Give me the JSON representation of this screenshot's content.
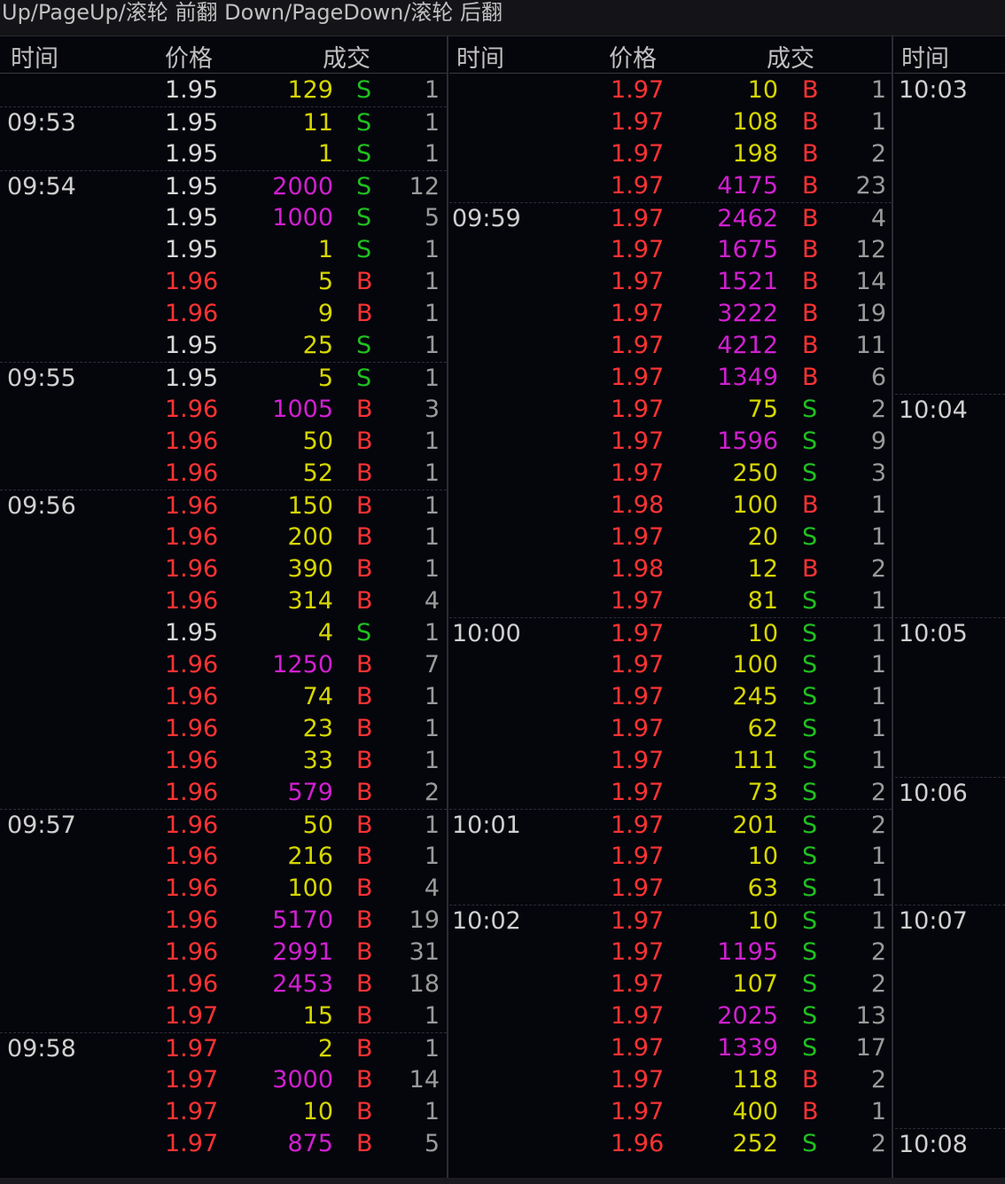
{
  "hint": "Up/PageUp/滚轮 前翻 Down/PageDown/滚轮 后翻",
  "headers": {
    "time": "时间",
    "price": "价格",
    "volume": "成交"
  },
  "left_rows": [
    {
      "t": "",
      "p": "1.95",
      "v": "129",
      "s": "S",
      "c": "1"
    },
    {
      "t": "09:53",
      "p": "1.95",
      "v": "11",
      "s": "S",
      "c": "1"
    },
    {
      "t": "",
      "p": "1.95",
      "v": "1",
      "s": "S",
      "c": "1"
    },
    {
      "t": "09:54",
      "p": "1.95",
      "v": "2000",
      "s": "S",
      "c": "12"
    },
    {
      "t": "",
      "p": "1.95",
      "v": "1000",
      "s": "S",
      "c": "5"
    },
    {
      "t": "",
      "p": "1.95",
      "v": "1",
      "s": "S",
      "c": "1"
    },
    {
      "t": "",
      "p": "1.96",
      "v": "5",
      "s": "B",
      "c": "1"
    },
    {
      "t": "",
      "p": "1.96",
      "v": "9",
      "s": "B",
      "c": "1"
    },
    {
      "t": "",
      "p": "1.95",
      "v": "25",
      "s": "S",
      "c": "1"
    },
    {
      "t": "09:55",
      "p": "1.95",
      "v": "5",
      "s": "S",
      "c": "1"
    },
    {
      "t": "",
      "p": "1.96",
      "v": "1005",
      "s": "B",
      "c": "3"
    },
    {
      "t": "",
      "p": "1.96",
      "v": "50",
      "s": "B",
      "c": "1"
    },
    {
      "t": "",
      "p": "1.96",
      "v": "52",
      "s": "B",
      "c": "1"
    },
    {
      "t": "09:56",
      "p": "1.96",
      "v": "150",
      "s": "B",
      "c": "1"
    },
    {
      "t": "",
      "p": "1.96",
      "v": "200",
      "s": "B",
      "c": "1"
    },
    {
      "t": "",
      "p": "1.96",
      "v": "390",
      "s": "B",
      "c": "1"
    },
    {
      "t": "",
      "p": "1.96",
      "v": "314",
      "s": "B",
      "c": "4"
    },
    {
      "t": "",
      "p": "1.95",
      "v": "4",
      "s": "S",
      "c": "1"
    },
    {
      "t": "",
      "p": "1.96",
      "v": "1250",
      "s": "B",
      "c": "7"
    },
    {
      "t": "",
      "p": "1.96",
      "v": "74",
      "s": "B",
      "c": "1"
    },
    {
      "t": "",
      "p": "1.96",
      "v": "23",
      "s": "B",
      "c": "1"
    },
    {
      "t": "",
      "p": "1.96",
      "v": "33",
      "s": "B",
      "c": "1"
    },
    {
      "t": "",
      "p": "1.96",
      "v": "579",
      "s": "B",
      "c": "2"
    },
    {
      "t": "09:57",
      "p": "1.96",
      "v": "50",
      "s": "B",
      "c": "1"
    },
    {
      "t": "",
      "p": "1.96",
      "v": "216",
      "s": "B",
      "c": "1"
    },
    {
      "t": "",
      "p": "1.96",
      "v": "100",
      "s": "B",
      "c": "4"
    },
    {
      "t": "",
      "p": "1.96",
      "v": "5170",
      "s": "B",
      "c": "19"
    },
    {
      "t": "",
      "p": "1.96",
      "v": "2991",
      "s": "B",
      "c": "31"
    },
    {
      "t": "",
      "p": "1.96",
      "v": "2453",
      "s": "B",
      "c": "18"
    },
    {
      "t": "",
      "p": "1.97",
      "v": "15",
      "s": "B",
      "c": "1"
    },
    {
      "t": "09:58",
      "p": "1.97",
      "v": "2",
      "s": "B",
      "c": "1"
    },
    {
      "t": "",
      "p": "1.97",
      "v": "3000",
      "s": "B",
      "c": "14"
    },
    {
      "t": "",
      "p": "1.97",
      "v": "10",
      "s": "B",
      "c": "1"
    },
    {
      "t": "",
      "p": "1.97",
      "v": "875",
      "s": "B",
      "c": "5"
    }
  ],
  "right_rows": [
    {
      "t": "",
      "p": "1.97",
      "v": "10",
      "s": "B",
      "c": "1"
    },
    {
      "t": "",
      "p": "1.97",
      "v": "108",
      "s": "B",
      "c": "1"
    },
    {
      "t": "",
      "p": "1.97",
      "v": "198",
      "s": "B",
      "c": "2"
    },
    {
      "t": "",
      "p": "1.97",
      "v": "4175",
      "s": "B",
      "c": "23"
    },
    {
      "t": "09:59",
      "p": "1.97",
      "v": "2462",
      "s": "B",
      "c": "4"
    },
    {
      "t": "",
      "p": "1.97",
      "v": "1675",
      "s": "B",
      "c": "12"
    },
    {
      "t": "",
      "p": "1.97",
      "v": "1521",
      "s": "B",
      "c": "14"
    },
    {
      "t": "",
      "p": "1.97",
      "v": "3222",
      "s": "B",
      "c": "19"
    },
    {
      "t": "",
      "p": "1.97",
      "v": "4212",
      "s": "B",
      "c": "11"
    },
    {
      "t": "",
      "p": "1.97",
      "v": "1349",
      "s": "B",
      "c": "6"
    },
    {
      "t": "",
      "p": "1.97",
      "v": "75",
      "s": "S",
      "c": "2"
    },
    {
      "t": "",
      "p": "1.97",
      "v": "1596",
      "s": "S",
      "c": "9"
    },
    {
      "t": "",
      "p": "1.97",
      "v": "250",
      "s": "S",
      "c": "3"
    },
    {
      "t": "",
      "p": "1.98",
      "v": "100",
      "s": "B",
      "c": "1"
    },
    {
      "t": "",
      "p": "1.97",
      "v": "20",
      "s": "S",
      "c": "1"
    },
    {
      "t": "",
      "p": "1.98",
      "v": "12",
      "s": "B",
      "c": "2"
    },
    {
      "t": "",
      "p": "1.97",
      "v": "81",
      "s": "S",
      "c": "1"
    },
    {
      "t": "10:00",
      "p": "1.97",
      "v": "10",
      "s": "S",
      "c": "1"
    },
    {
      "t": "",
      "p": "1.97",
      "v": "100",
      "s": "S",
      "c": "1"
    },
    {
      "t": "",
      "p": "1.97",
      "v": "245",
      "s": "S",
      "c": "1"
    },
    {
      "t": "",
      "p": "1.97",
      "v": "62",
      "s": "S",
      "c": "1"
    },
    {
      "t": "",
      "p": "1.97",
      "v": "111",
      "s": "S",
      "c": "1"
    },
    {
      "t": "",
      "p": "1.97",
      "v": "73",
      "s": "S",
      "c": "2"
    },
    {
      "t": "10:01",
      "p": "1.97",
      "v": "201",
      "s": "S",
      "c": "2"
    },
    {
      "t": "",
      "p": "1.97",
      "v": "10",
      "s": "S",
      "c": "1"
    },
    {
      "t": "",
      "p": "1.97",
      "v": "63",
      "s": "S",
      "c": "1"
    },
    {
      "t": "10:02",
      "p": "1.97",
      "v": "10",
      "s": "S",
      "c": "1"
    },
    {
      "t": "",
      "p": "1.97",
      "v": "1195",
      "s": "S",
      "c": "2"
    },
    {
      "t": "",
      "p": "1.97",
      "v": "107",
      "s": "S",
      "c": "2"
    },
    {
      "t": "",
      "p": "1.97",
      "v": "2025",
      "s": "S",
      "c": "13"
    },
    {
      "t": "",
      "p": "1.97",
      "v": "1339",
      "s": "S",
      "c": "17"
    },
    {
      "t": "",
      "p": "1.97",
      "v": "118",
      "s": "B",
      "c": "2"
    },
    {
      "t": "",
      "p": "1.97",
      "v": "400",
      "s": "B",
      "c": "1"
    },
    {
      "t": "",
      "p": "1.96",
      "v": "252",
      "s": "S",
      "c": "2"
    }
  ],
  "third_col_times": [
    {
      "t": "10:03",
      "row": 0
    },
    {
      "t": "10:04",
      "row": 10
    },
    {
      "t": "10:05",
      "row": 17
    },
    {
      "t": "10:06",
      "row": 22
    },
    {
      "t": "10:07",
      "row": 26
    },
    {
      "t": "10:08",
      "row": 33
    }
  ],
  "colors": {
    "up": "#ff3333",
    "flat": "#d8d8d8",
    "buy": "#ff3333",
    "sell": "#20c020",
    "small_vol": "#d6d600",
    "big_vol": "#d020d0"
  }
}
